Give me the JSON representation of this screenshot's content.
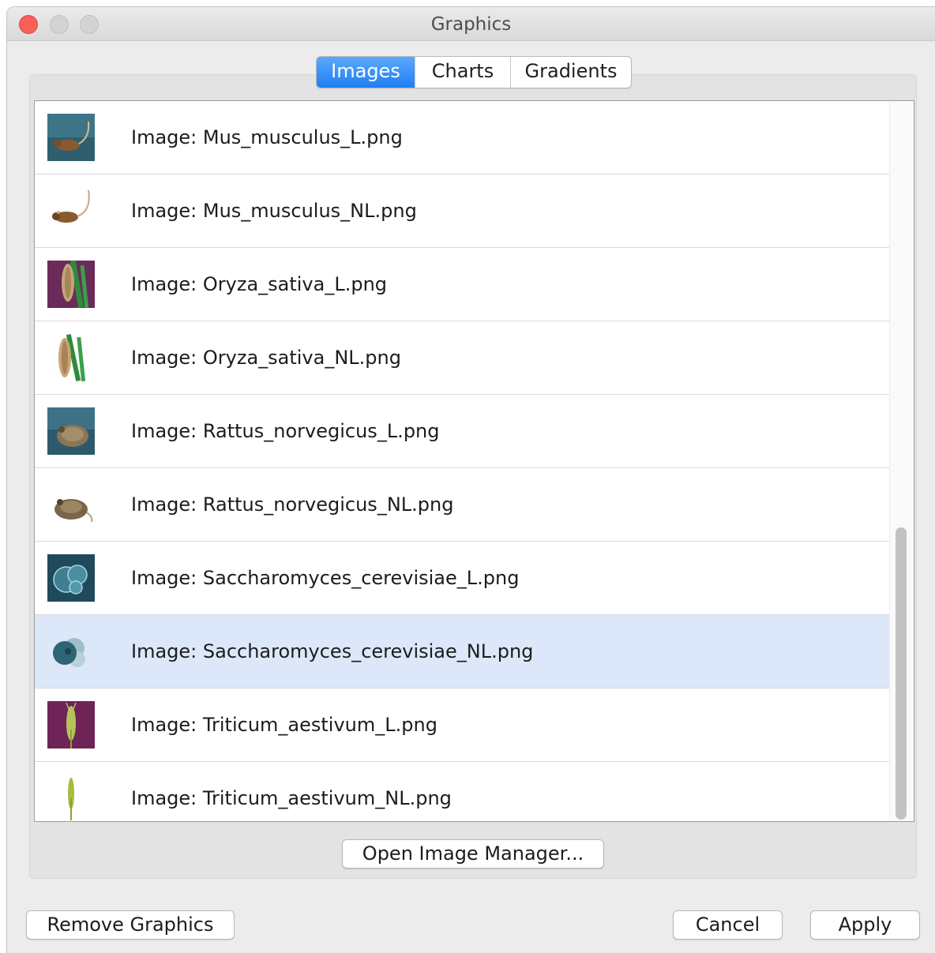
{
  "window": {
    "title": "Graphics"
  },
  "tabs": [
    {
      "label": "Images",
      "active": true
    },
    {
      "label": "Charts",
      "active": false
    },
    {
      "label": "Gradients",
      "active": false
    }
  ],
  "images": [
    {
      "label": "Image: Mus_musculus_L.png",
      "icon": "mouse-lit-icon",
      "selected": false
    },
    {
      "label": "Image: Mus_musculus_NL.png",
      "icon": "mouse-icon",
      "selected": false
    },
    {
      "label": "Image: Oryza_sativa_L.png",
      "icon": "rice-lit-icon",
      "selected": false
    },
    {
      "label": "Image: Oryza_sativa_NL.png",
      "icon": "rice-icon",
      "selected": false
    },
    {
      "label": "Image: Rattus_norvegicus_L.png",
      "icon": "rat-lit-icon",
      "selected": false
    },
    {
      "label": "Image: Rattus_norvegicus_NL.png",
      "icon": "rat-icon",
      "selected": false
    },
    {
      "label": "Image: Saccharomyces_cerevisiae_L.png",
      "icon": "yeast-lit-icon",
      "selected": false
    },
    {
      "label": "Image: Saccharomyces_cerevisiae_NL.png",
      "icon": "yeast-icon",
      "selected": true
    },
    {
      "label": "Image: Triticum_aestivum_L.png",
      "icon": "wheat-lit-icon",
      "selected": false
    },
    {
      "label": "Image: Triticum_aestivum_NL.png",
      "icon": "wheat-icon",
      "selected": false
    }
  ],
  "buttons": {
    "open_manager": "Open Image Manager...",
    "remove": "Remove Graphics",
    "cancel": "Cancel",
    "apply": "Apply"
  },
  "colors": {
    "accent": "#1f7ef4",
    "selection": "#dce8fa",
    "close": "#fc5f57"
  }
}
